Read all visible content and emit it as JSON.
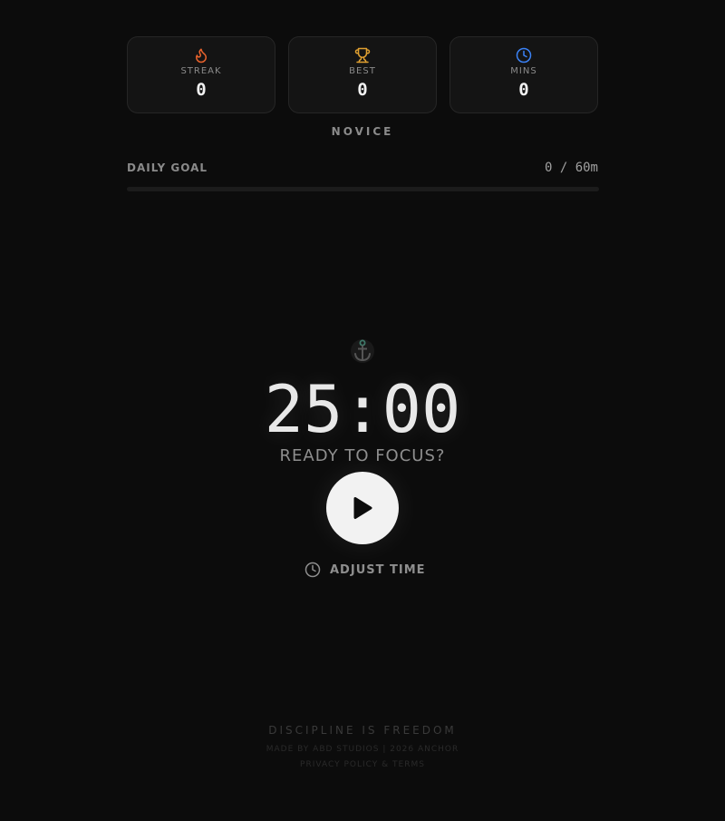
{
  "stats": [
    {
      "icon": "flame-icon",
      "label": "STREAK",
      "value": "0",
      "color": "#e8622c"
    },
    {
      "icon": "trophy-icon",
      "label": "BEST",
      "value": "0",
      "color": "#e0a030"
    },
    {
      "icon": "clock-icon",
      "label": "MINS",
      "value": "0",
      "color": "#3b82f6"
    }
  ],
  "rank": "NOVICE",
  "goal": {
    "label": "DAILY GOAL",
    "value": "0 / 60m",
    "progress": 0
  },
  "timer": {
    "icon": "anchor-icon",
    "time": "25:00",
    "status": "READY TO FOCUS?",
    "play_icon": "play-icon",
    "adjust_label": "ADJUST TIME"
  },
  "footer": {
    "motto": "DISCIPLINE IS FREEDOM",
    "credit": "MADE BY ABD STUDIOS | 2026 ANCHOR",
    "privacy": "PRIVACY POLICY",
    "separator": "&",
    "terms": "TERMS"
  },
  "colors": {
    "background": "#0c0c0c",
    "card": "#141414",
    "text": "#e8e8e8",
    "muted": "#8e8e8e"
  }
}
